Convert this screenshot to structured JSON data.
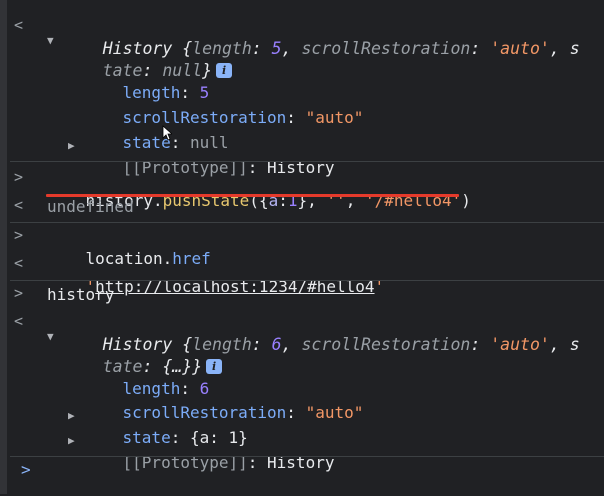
{
  "console": {
    "entries": [
      {
        "id": "history-obj-1",
        "header_a": "History {",
        "header_length_key": "length",
        "header_length_val": "5",
        "header_scroll_key": "scrollRestoration",
        "header_scroll_val": "'auto'",
        "header_wrap_1": ", s",
        "header_wrap_2a": "tate",
        "header_state_val": "null",
        "header_close": "}",
        "props": [
          {
            "key": "length",
            "val": "5"
          },
          {
            "key": "scrollRestoration",
            "val": "\"auto\""
          },
          {
            "key": "state",
            "val": "null"
          }
        ],
        "proto_label": "[[Prototype]]",
        "proto_val": "History"
      }
    ],
    "input_1": {
      "obj": "history",
      "dot": ".",
      "method": "pushState",
      "open": "(",
      "brace_open": "{",
      "a_key": "a",
      "colon": ":",
      "a_val": "1",
      "brace_close": "}",
      "comma1": ", ",
      "empty_str": "''",
      "comma2": ", ",
      "url_str": "'/#hello4'",
      "close": ")"
    },
    "output_1": "undefined",
    "input_2": {
      "obj": "location",
      "dot": ".",
      "prop": "href"
    },
    "output_2": {
      "quote_open": "'",
      "url": "http://localhost:1234/#hello4",
      "quote_close": "'"
    },
    "input_3": "history",
    "history_obj_2": {
      "header_a": "History {",
      "header_length_key": "length",
      "header_length_val": "6",
      "header_scroll_key": "scrollRestoration",
      "header_scroll_val": "'auto'",
      "header_wrap_1": ", s",
      "header_wrap_2a": "tate",
      "header_state_val": "{…}",
      "header_close": "}",
      "props": [
        {
          "key": "length",
          "val": "6"
        },
        {
          "key": "scrollRestoration",
          "val": "\"auto\""
        }
      ],
      "state_label": "state",
      "state_val": "{a: 1}",
      "proto_label": "[[Prototype]]",
      "proto_val": "History"
    },
    "info_badge": "i",
    "prompt_glyph": ">",
    "result_glyph": "<",
    "colors": {
      "background": "#202124",
      "underline_accent": "#e53a2b",
      "prompt_blue": "#8ab4f8"
    }
  }
}
